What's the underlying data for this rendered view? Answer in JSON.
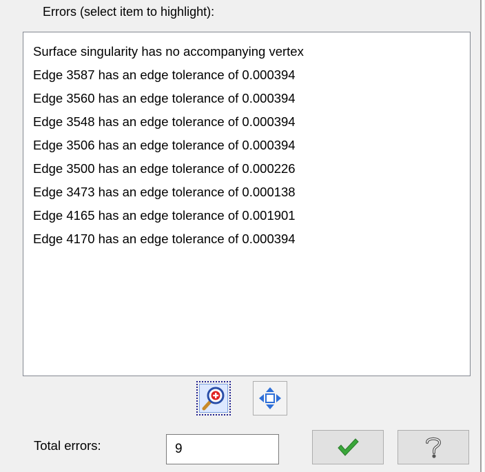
{
  "errors_group": {
    "label": "Errors (select item to highlight):",
    "items": [
      "Surface singularity has no accompanying vertex",
      "Edge 3587 has an edge tolerance of 0.000394",
      "Edge 3560 has an edge tolerance of 0.000394",
      "Edge 3548 has an edge tolerance of 0.000394",
      "Edge 3506 has an edge tolerance of 0.000394",
      "Edge 3500 has an edge tolerance of 0.000226",
      "Edge 3473 has an edge tolerance of 0.000138",
      "Edge 4165 has an edge tolerance of 0.001901",
      "Edge 4170 has an edge tolerance of 0.000394"
    ]
  },
  "toolbar": {
    "zoom_icon": "zoom-in-icon",
    "fit_icon": "pan-arrows-icon"
  },
  "footer": {
    "total_label": "Total errors:",
    "total_value": "9",
    "ok_icon": "checkmark-icon",
    "help_icon": "question-mark-icon"
  },
  "colors": {
    "check": "#3aa63a",
    "arrows": "#2e6fd8",
    "zoom_plus": "#e02020"
  }
}
